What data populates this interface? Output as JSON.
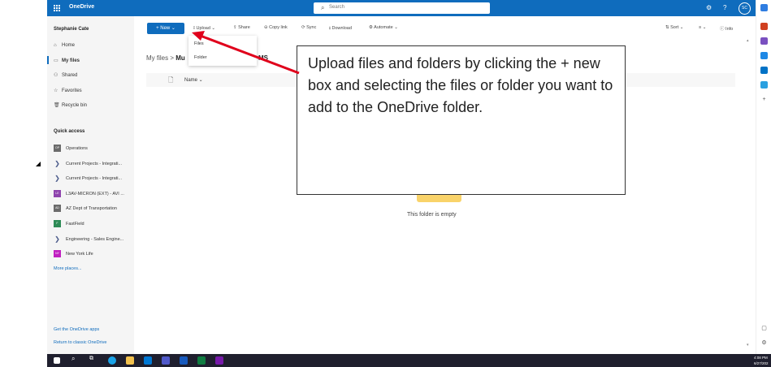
{
  "app": {
    "name": "OneDrive",
    "search_placeholder": "Search",
    "user_initials": "SC"
  },
  "nav": {
    "user": "Stephanie Cate",
    "items": [
      {
        "label": "Home",
        "icon": "⌂"
      },
      {
        "label": "My files",
        "icon": "▭"
      },
      {
        "label": "Shared",
        "icon": "⚇"
      },
      {
        "label": "Favorites",
        "icon": "☆"
      },
      {
        "label": "Recycle bin",
        "icon": "🗑"
      }
    ],
    "quick_access_title": "Quick access",
    "quick_access": [
      {
        "label": "Operations",
        "badge": "OP",
        "color": "#6b6b6b"
      },
      {
        "label": "Current Projects - Integrati...",
        "badge": "",
        "color": "#4a5a8a"
      },
      {
        "label": "Current Projects - Integrati...",
        "badge": "",
        "color": "#4a5a8a"
      },
      {
        "label": "L3AV-MICRON (EXT) - AVI ...",
        "badge": "LE",
        "color": "#8e44ad"
      },
      {
        "label": "AZ Dept of Transportation",
        "badge": "AD",
        "color": "#6b6b6b"
      },
      {
        "label": "FastField",
        "badge": "F",
        "color": "#2e8b57"
      },
      {
        "label": "Engineering - Sales Engine...",
        "badge": "",
        "color": "#4a5a8a"
      },
      {
        "label": "New York Life",
        "badge": "NY",
        "color": "#c020c0"
      }
    ],
    "more_places": "More places...",
    "footer_links": [
      "Get the OneDrive apps",
      "Return to classic OneDrive"
    ]
  },
  "commands": {
    "new": "+ New ⌄",
    "left": [
      {
        "label": "Upload ⌄",
        "icon": "⭱"
      },
      {
        "label": "Share",
        "icon": "⇪"
      },
      {
        "label": "Copy link",
        "icon": "⊝"
      },
      {
        "label": "Sync",
        "icon": "⟳"
      },
      {
        "label": "Download",
        "icon": "⭳"
      },
      {
        "label": "Automate ⌄",
        "icon": "⚙"
      }
    ],
    "right": [
      {
        "label": "Sort ⌄",
        "icon": "⇅"
      },
      {
        "label": "≡ ⌄",
        "icon": ""
      },
      {
        "label": "Info",
        "icon": "ⓘ"
      }
    ]
  },
  "upload_menu": [
    "Files",
    "Folder"
  ],
  "breadcrumb": {
    "root": "My files",
    "sep": ">",
    "current_start": "Mu",
    "current_end": "MS"
  },
  "list": {
    "name_header": "Name ⌄",
    "empty_text": "This folder is empty"
  },
  "callout_text": "Upload files and folders by clicking the + new box and selecting the files or folder you want to add to the OneDrive folder.",
  "taskbar": {
    "time": "4:08 PM",
    "date": "6/27/202"
  },
  "colors": {
    "brand": "#0f6cbd",
    "arrow": "#e0001b"
  }
}
